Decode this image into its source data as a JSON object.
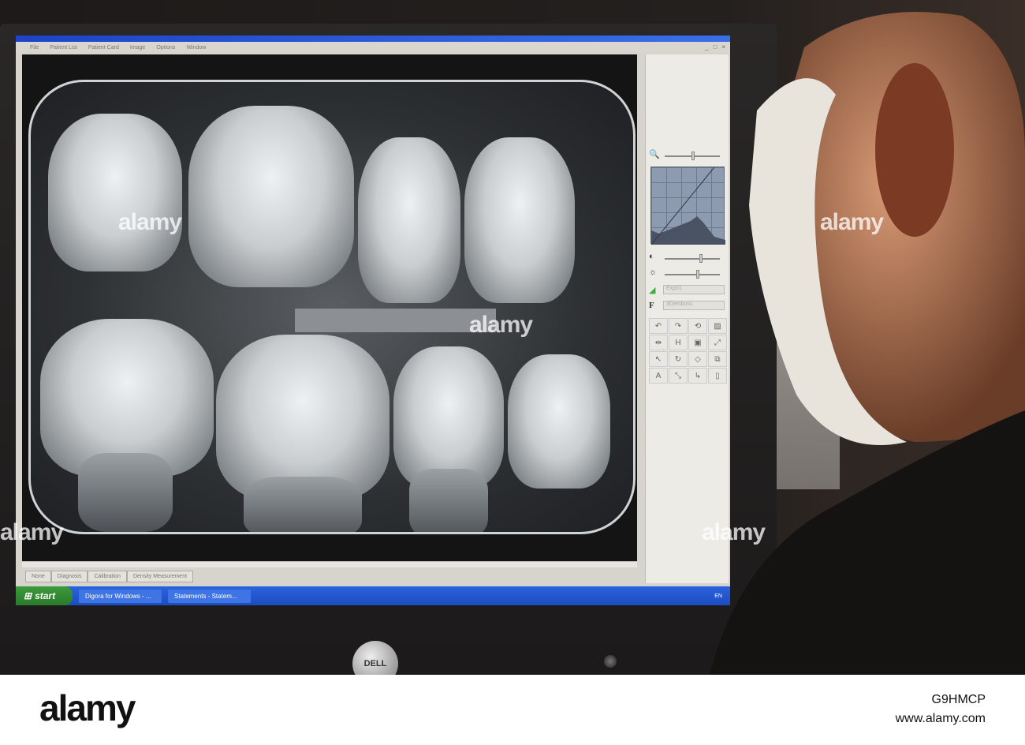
{
  "app": {
    "menu": [
      "File",
      "Patient List",
      "Patient Card",
      "Image",
      "Options",
      "Window"
    ],
    "window_controls": [
      "_",
      "□",
      "×"
    ],
    "bottom_tabs": [
      "None",
      "Diagnosis",
      "Calibration",
      "Density Measurement"
    ],
    "side_panel": {
      "dropdown_1": "Exp01",
      "dropdown_2": "3Demboss",
      "tools": [
        "↶",
        "↷",
        "⟲",
        "▨",
        "⇹",
        "H",
        "▣",
        "⤢",
        "↖",
        "↻",
        "◇",
        "⧉",
        "A",
        "⤡",
        "↳",
        "▯"
      ]
    }
  },
  "taskbar": {
    "start_label": "start",
    "tasks": [
      "Digora for Windows - ...",
      "Statements - Statem..."
    ],
    "tray_text": "EN"
  },
  "monitor": {
    "brand": "DELL"
  },
  "watermark": {
    "text": "alamy"
  },
  "footer": {
    "brand": "alamy",
    "image_id": "G9HMCP",
    "site": "www.alamy.com"
  }
}
